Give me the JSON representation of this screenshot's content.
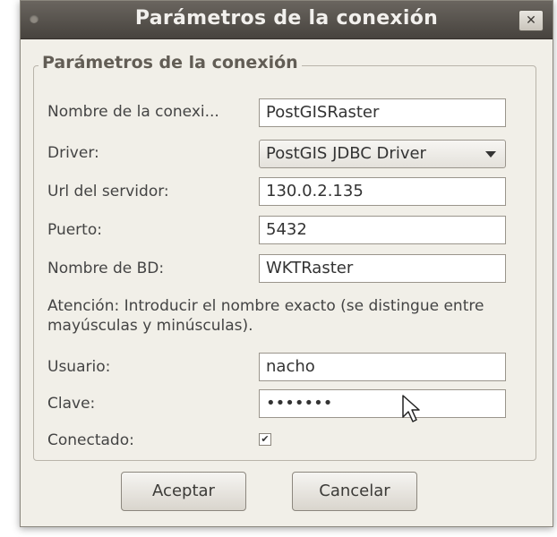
{
  "window": {
    "title": "Parámetros de la conexión"
  },
  "form": {
    "section_title": "Parámetros de la conexión",
    "connection_name": {
      "label": "Nombre de la conexi...",
      "value": "PostGISRaster"
    },
    "driver": {
      "label": "Driver:",
      "value": "PostGIS JDBC Driver"
    },
    "server_url": {
      "label": "Url del servidor:",
      "value": "130.0.2.135"
    },
    "port": {
      "label": "Puerto:",
      "value": "5432"
    },
    "db_name": {
      "label": "Nombre de BD:",
      "value": "WKTRaster"
    },
    "notice": "Atención: Introducir el nombre exacto (se distingue entre mayúsculas y minúsculas).",
    "user": {
      "label": "Usuario:",
      "value": "nacho"
    },
    "password": {
      "label": "Clave:",
      "value": "•••••••"
    },
    "connected": {
      "label": "Conectado:",
      "checked": true
    }
  },
  "buttons": {
    "accept": "Aceptar",
    "cancel": "Cancelar"
  },
  "colors": {
    "titlebar": "#4f4b46",
    "dialog_bg": "#f1efe8"
  }
}
